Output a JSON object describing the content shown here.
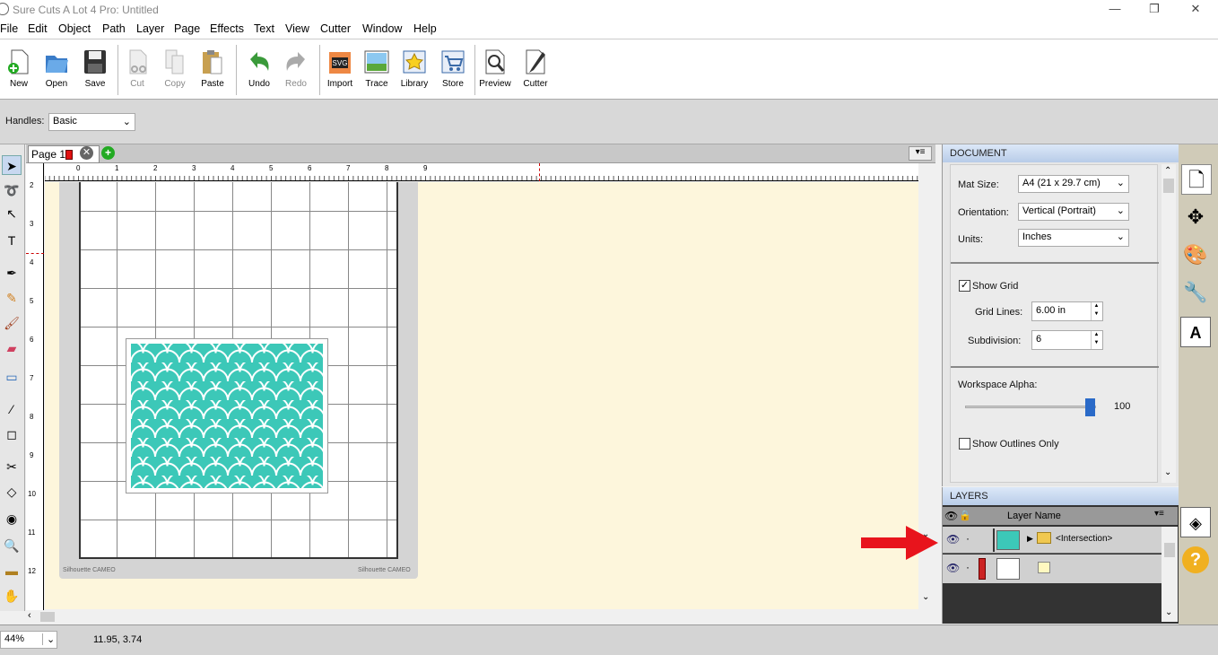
{
  "window": {
    "title": "Sure Cuts A Lot 4 Pro: Untitled",
    "minimize": "—",
    "restore": "❐",
    "close": "✕"
  },
  "menu": [
    "File",
    "Edit",
    "Object",
    "Path",
    "Layer",
    "Page",
    "Effects",
    "Text",
    "View",
    "Cutter",
    "Window",
    "Help"
  ],
  "toolbar": [
    {
      "label": "New",
      "icon": "new-icon",
      "enabled": true
    },
    {
      "label": "Open",
      "icon": "open-icon",
      "enabled": true
    },
    {
      "label": "Save",
      "icon": "save-icon",
      "enabled": true
    },
    {
      "label": "Cut",
      "icon": "cut-icon",
      "enabled": false
    },
    {
      "label": "Copy",
      "icon": "copy-icon",
      "enabled": false
    },
    {
      "label": "Paste",
      "icon": "paste-icon",
      "enabled": true
    },
    {
      "label": "Undo",
      "icon": "undo-icon",
      "enabled": true
    },
    {
      "label": "Redo",
      "icon": "redo-icon",
      "enabled": false
    },
    {
      "label": "Import",
      "icon": "import-svg-icon",
      "enabled": true
    },
    {
      "label": "Trace",
      "icon": "trace-icon",
      "enabled": true
    },
    {
      "label": "Library",
      "icon": "library-icon",
      "enabled": true
    },
    {
      "label": "Store",
      "icon": "store-icon",
      "enabled": true
    },
    {
      "label": "Preview",
      "icon": "preview-icon",
      "enabled": true
    },
    {
      "label": "Cutter",
      "icon": "cutter-icon",
      "enabled": true
    }
  ],
  "handles": {
    "label": "Handles:",
    "value": "Basic"
  },
  "page_tab": {
    "label": "Page 1"
  },
  "ruler": {
    "h_ticks": [
      "0",
      "1",
      "2",
      "3",
      "4",
      "5",
      "6",
      "7",
      "8",
      "9"
    ],
    "v_ticks": [
      "2",
      "3",
      "4",
      "5",
      "6",
      "7",
      "8",
      "9",
      "10",
      "11",
      "12"
    ]
  },
  "mat": {
    "brand_left": "Silhouette CAMEO",
    "brand_right": "Silhouette CAMEO"
  },
  "status": {
    "zoom": "44%",
    "coords": "11.95, 3.74"
  },
  "document_panel": {
    "header": "DOCUMENT",
    "mat_size_label": "Mat Size:",
    "mat_size": "A4 (21 x 29.7 cm)",
    "orientation_label": "Orientation:",
    "orientation": "Vertical (Portrait)",
    "units_label": "Units:",
    "units": "Inches",
    "show_grid": "Show Grid",
    "show_grid_checked": true,
    "grid_lines_label": "Grid Lines:",
    "grid_lines": "6.00 in",
    "subdivision_label": "Subdivision:",
    "subdivision": "6",
    "alpha_label": "Workspace Alpha:",
    "alpha_value": "100",
    "alpha_level": 1.0,
    "outlines_only": "Show Outlines Only",
    "outlines_checked": false
  },
  "layers_panel": {
    "header": "LAYERS",
    "column": "Layer Name",
    "rows": [
      {
        "name": "<Intersection>",
        "color": "#3cc8b8"
      },
      {
        "name": "",
        "color": "#cc2222"
      }
    ]
  },
  "colors": {
    "pattern": "#3cc8b8",
    "canvas": "#fdf6dc",
    "arrow": "#e8141c",
    "page_marker": "#e01010"
  }
}
